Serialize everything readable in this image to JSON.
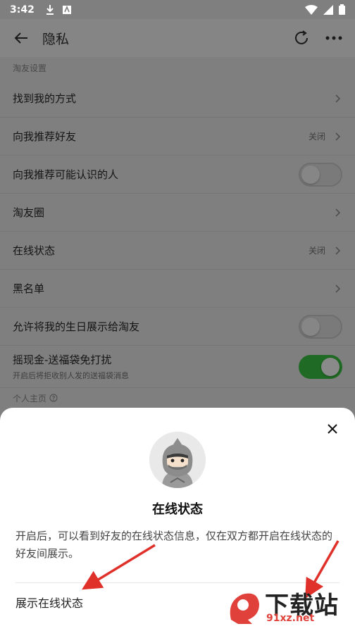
{
  "status_bar": {
    "time": "3:42"
  },
  "app_bar": {
    "title": "隐私"
  },
  "settings": {
    "section_title": "淘友设置",
    "rows": [
      {
        "label": "找到我的方式",
        "value": "",
        "control": "chevron"
      },
      {
        "label": "向我推荐好友",
        "value": "关闭",
        "control": "chevron"
      },
      {
        "label": "向我推荐可能认识的人",
        "value": "",
        "control": "toggle",
        "on": false
      },
      {
        "label": "淘友圈",
        "value": "",
        "control": "chevron"
      },
      {
        "label": "在线状态",
        "value": "关闭",
        "control": "chevron"
      },
      {
        "label": "黑名单",
        "value": "",
        "control": "chevron"
      },
      {
        "label": "允许将我的生日展示给淘友",
        "value": "",
        "control": "toggle",
        "on": false
      },
      {
        "label": "摇现金-送福袋免打扰",
        "sub": "开启后将拒收别人发的送福袋消息",
        "value": "",
        "control": "toggle",
        "on": true
      }
    ],
    "section2_title": "个人主页"
  },
  "sheet": {
    "title": "在线状态",
    "description": "开启后，可以看到好友的在线状态信息，仅在双方都开启在线状态的好友间展示。",
    "option_label": "展示在线状态"
  },
  "watermark": {
    "brand": "下载站",
    "url": "91xz.net"
  },
  "colors": {
    "accent_toggle_on": "#1f6a24",
    "arrow_red": "#e0302a"
  }
}
